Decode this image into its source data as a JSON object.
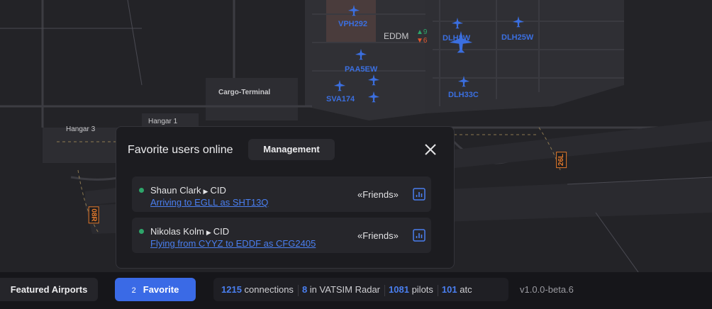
{
  "map": {
    "area_labels": {
      "cargo": "Cargo-Terminal",
      "hangar3": "Hangar 3",
      "hangar1": "Hangar 1"
    },
    "airport": {
      "code": "EDDM",
      "count_up": "9",
      "count_down": "6"
    },
    "callsigns": [
      "VPH292",
      "PAA5EW",
      "SVA174",
      "DLH2W",
      "DLH25W",
      "DLH33C"
    ],
    "runways": [
      "26L",
      "08R"
    ],
    "colors": {
      "callsign": "#3b6fe0",
      "runway": "#e47a2c",
      "online": "#2ea56a",
      "accent": "#3a6ae6"
    }
  },
  "modal": {
    "title": "Favorite users online",
    "management_label": "Management",
    "users": [
      {
        "name": "Shaun Clark",
        "cid": "CID",
        "flight": "Arriving to EGLL as SHT13Q",
        "group": "«Friends»"
      },
      {
        "name": "Nikolas Kolm",
        "cid": "CID",
        "flight": "Flying from CYYZ to EDDF as CFG2405",
        "group": "«Friends»"
      }
    ]
  },
  "bottombar": {
    "featured_label": "Featured Airports",
    "favorite_count": "2",
    "favorite_label": "Favorite",
    "connections_count": "1215",
    "connections_label": "connections",
    "vatsim_count": "8",
    "vatsim_label": "in VATSIM Radar",
    "pilots_count": "1081",
    "pilots_label": "pilots",
    "atc_count": "101",
    "atc_label": "atc",
    "version": "v1.0.0-beta.6"
  }
}
